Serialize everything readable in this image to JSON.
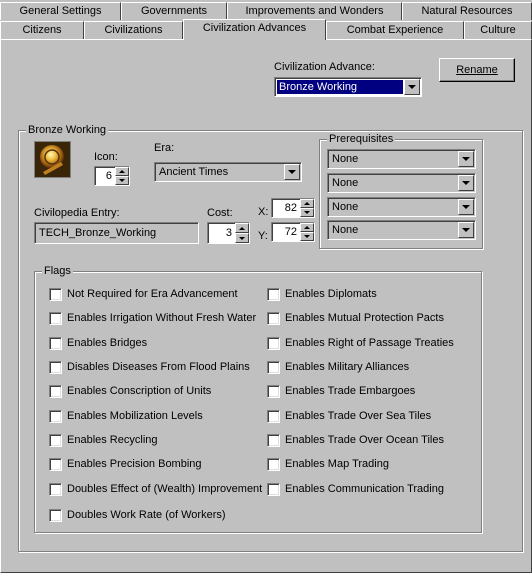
{
  "tabs_row1": [
    {
      "label": "General Settings"
    },
    {
      "label": "Governments"
    },
    {
      "label": "Improvements and Wonders"
    },
    {
      "label": "Natural Resources"
    }
  ],
  "tabs_row2": [
    {
      "label": "Citizens"
    },
    {
      "label": "Civilizations"
    },
    {
      "label": "Civilization Advances",
      "active": true
    },
    {
      "label": "Combat Experience"
    },
    {
      "label": "Culture"
    }
  ],
  "advance_selector": {
    "label": "Civilization Advance:",
    "value": "Bronze Working",
    "rename_label": "Rename"
  },
  "advance": {
    "group_title": "Bronze Working",
    "icon_label": "Icon:",
    "icon_value": "6",
    "era_label": "Era:",
    "era_value": "Ancient Times",
    "civilopedia_label": "Civilopedia Entry:",
    "civilopedia_value": "TECH_Bronze_Working",
    "cost_label": "Cost:",
    "cost_value": "3",
    "x_label": "X:",
    "x_value": "82",
    "y_label": "Y:",
    "y_value": "72"
  },
  "prerequisites": {
    "title": "Prerequisites",
    "items": [
      "None",
      "None",
      "None",
      "None"
    ]
  },
  "flags": {
    "title": "Flags",
    "left": [
      {
        "label": "Not Required for Era Advancement",
        "checked": false
      },
      {
        "label": "Enables Irrigation Without Fresh Water",
        "checked": false
      },
      {
        "label": "Enables Bridges",
        "checked": false
      },
      {
        "label": "Disables Diseases From Flood Plains",
        "checked": false
      },
      {
        "label": "Enables Conscription of Units",
        "checked": false
      },
      {
        "label": "Enables Mobilization Levels",
        "checked": false
      },
      {
        "label": "Enables Recycling",
        "checked": false
      },
      {
        "label": "Enables Precision Bombing",
        "checked": false
      },
      {
        "label": "Doubles Effect of (Wealth) Improvement",
        "checked": false
      },
      {
        "label": "Doubles Work Rate (of Workers)",
        "checked": false
      }
    ],
    "right": [
      {
        "label": "Enables Diplomats",
        "checked": false
      },
      {
        "label": "Enables Mutual Protection Pacts",
        "checked": false
      },
      {
        "label": "Enables Right of Passage Treaties",
        "checked": false
      },
      {
        "label": "Enables Military Alliances",
        "checked": false
      },
      {
        "label": "Enables Trade Embargoes",
        "checked": false
      },
      {
        "label": "Enables Trade Over Sea Tiles",
        "checked": false
      },
      {
        "label": "Enables Trade Over Ocean Tiles",
        "checked": false
      },
      {
        "label": "Enables Map Trading",
        "checked": false
      },
      {
        "label": "Enables Communication Trading",
        "checked": false
      }
    ]
  },
  "icons": {
    "advance_icon": "bronze-working-icon",
    "dropdown": "chevron-down-icon",
    "spin_up": "spin-up-icon",
    "spin_down": "spin-down-icon"
  },
  "colors": {
    "face": "#c0c0c0",
    "selection": "#000080"
  }
}
